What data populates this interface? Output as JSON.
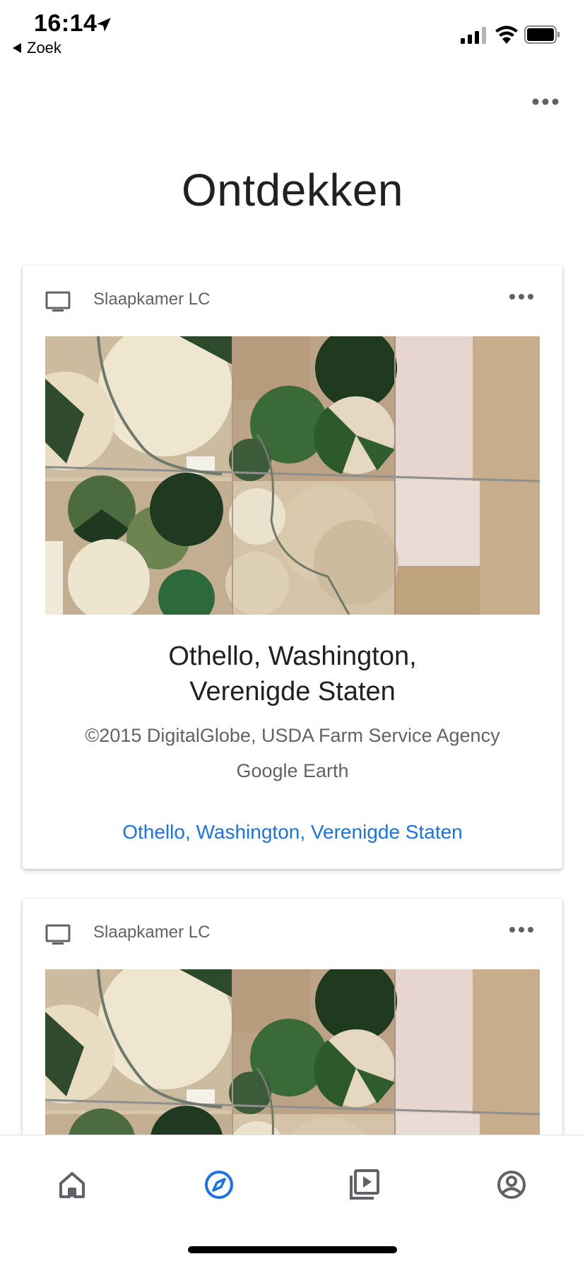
{
  "status_bar": {
    "time": "16:14",
    "back_label": "Zoek",
    "icons": [
      "location-arrow-icon",
      "signal-icon",
      "wifi-icon",
      "battery-icon"
    ]
  },
  "header": {
    "title": "Ontdekken",
    "more_icon": "more-horizontal-icon"
  },
  "cards": [
    {
      "device_icon": "tv-icon",
      "device_name": "Slaapkamer LC",
      "title_line1": "Othello, Washington,",
      "title_line2": "Verenigde Staten",
      "credit_line1": "©2015 DigitalGlobe, USDA Farm Service Agency",
      "credit_line2": "Google Earth",
      "link": "Othello, Washington, Verenigde Staten"
    },
    {
      "device_icon": "tv-icon",
      "device_name": "Slaapkamer LC"
    }
  ],
  "bottom_nav": {
    "items": [
      {
        "icon": "home-icon",
        "active": false
      },
      {
        "icon": "compass-icon",
        "active": true
      },
      {
        "icon": "media-icon",
        "active": false
      },
      {
        "icon": "account-icon",
        "active": false
      }
    ]
  },
  "colors": {
    "accent": "#1a73e8",
    "text_primary": "#202124",
    "text_secondary": "#5f6368",
    "nav_inactive": "#5f6368"
  }
}
